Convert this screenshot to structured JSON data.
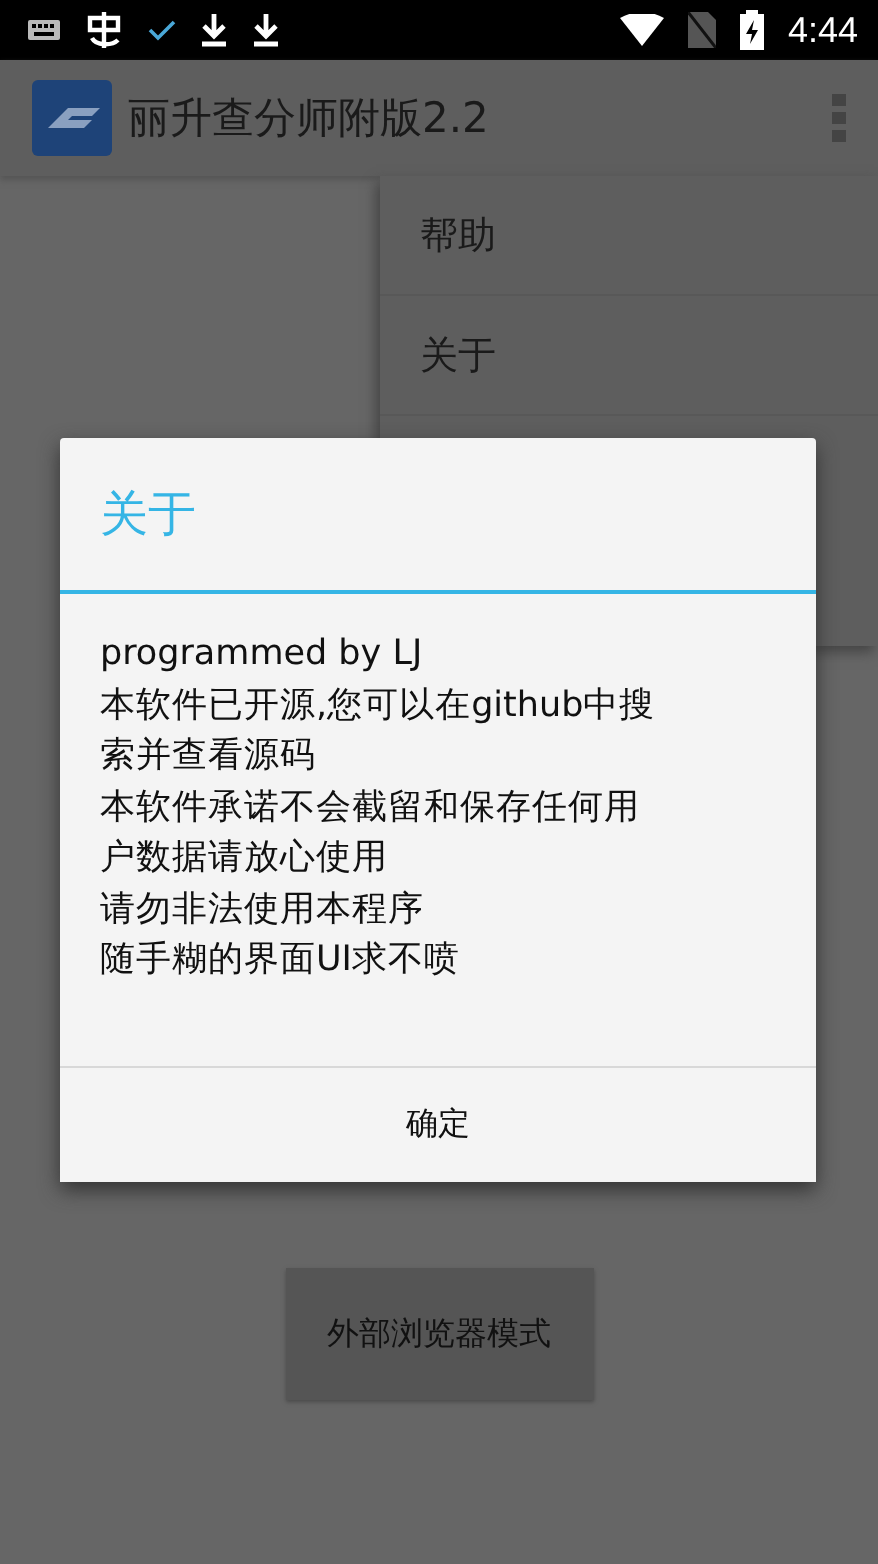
{
  "status_bar": {
    "time": "4:44"
  },
  "app_bar": {
    "title": "丽升查分师附版2.2"
  },
  "overflow_menu": {
    "items": [
      {
        "label": "帮助"
      },
      {
        "label": "关于"
      }
    ]
  },
  "main": {
    "button": "外部浏览器模式"
  },
  "dialog": {
    "title": "关于",
    "lines": [
      "programmed by LJ",
      "本软件已开源,您可以在github中搜",
      "索并查看源码",
      "本软件承诺不会截留和保存任何用",
      "户数据请放心使用",
      "请勿非法使用本程序",
      "随手糊的界面UI求不喷"
    ],
    "button": "确定"
  }
}
